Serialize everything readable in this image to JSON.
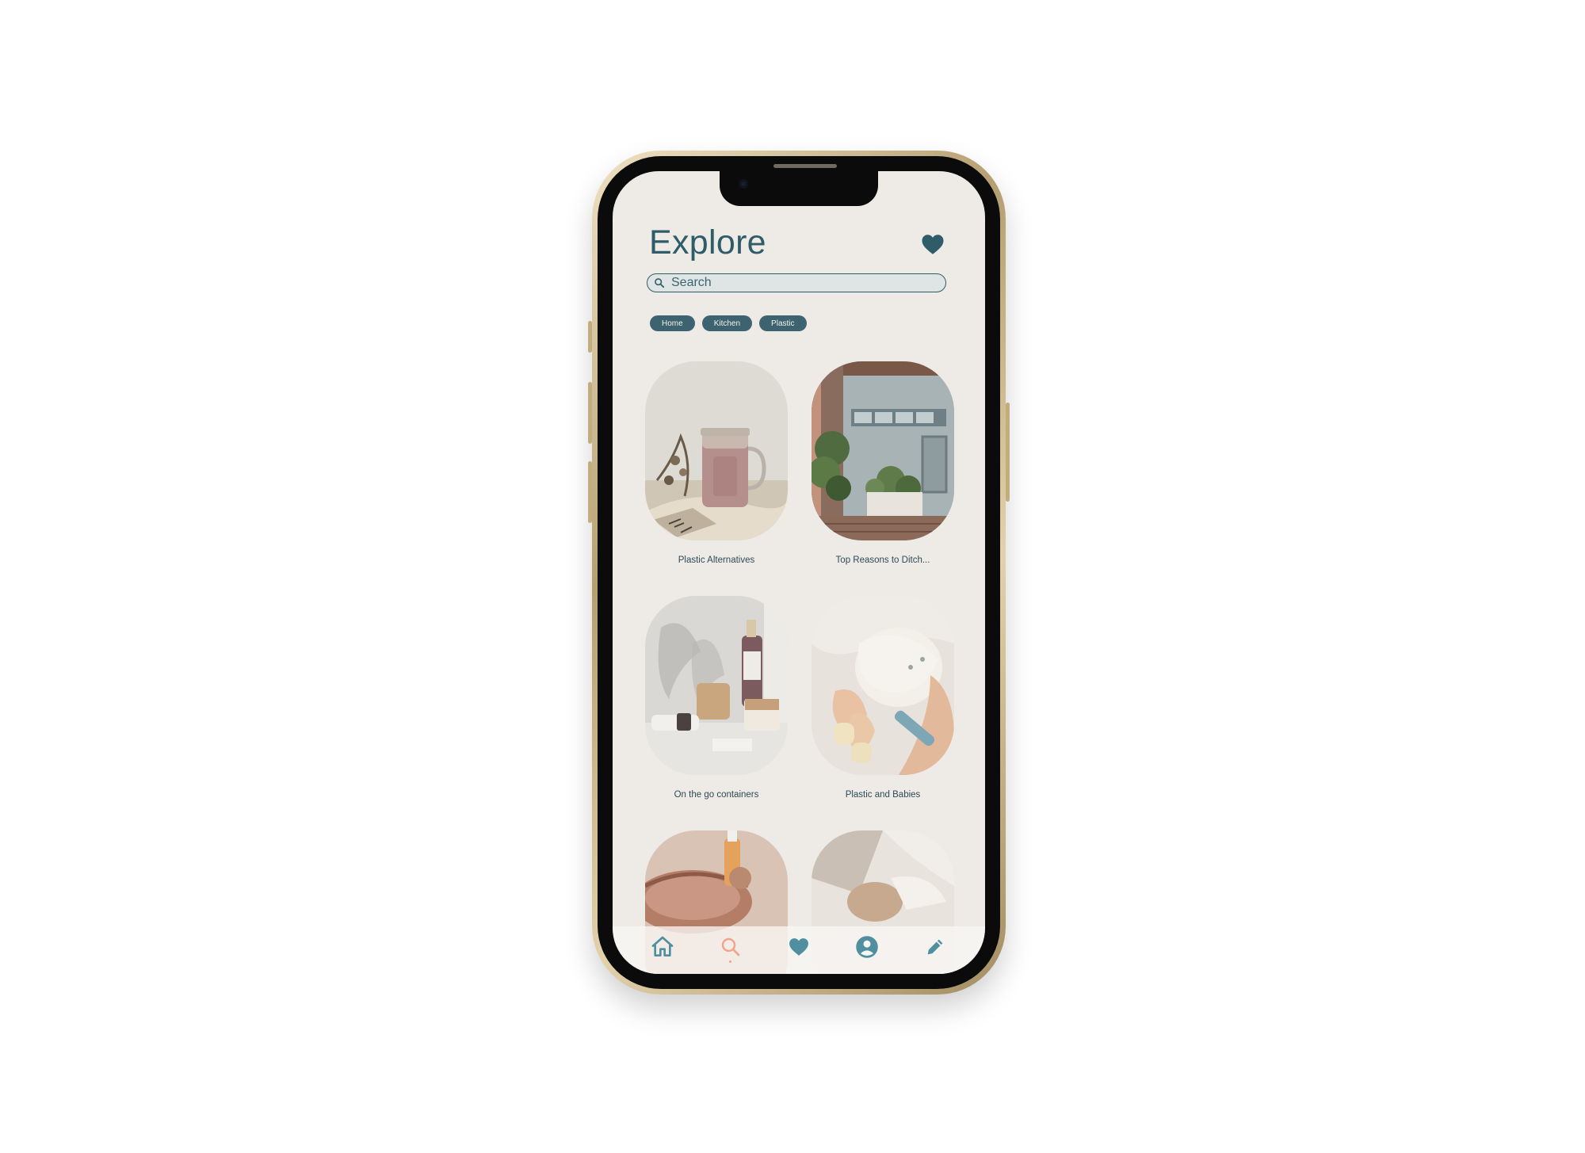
{
  "header": {
    "title": "Explore",
    "favorites_icon": "heart-icon"
  },
  "search": {
    "placeholder": "Search",
    "value": "",
    "icon": "search-icon"
  },
  "filters": [
    {
      "label": "Home"
    },
    {
      "label": "Kitchen"
    },
    {
      "label": "Plastic"
    }
  ],
  "cards": [
    {
      "label": "Plastic Alternatives"
    },
    {
      "label": "Top Reasons to Ditch..."
    },
    {
      "label": "On the go containers"
    },
    {
      "label": "Plastic and Babies"
    },
    {
      "label": ""
    },
    {
      "label": ""
    }
  ],
  "nav": {
    "items": [
      {
        "icon": "home-icon"
      },
      {
        "icon": "search-icon",
        "active": true
      },
      {
        "icon": "heart-icon"
      },
      {
        "icon": "profile-icon"
      },
      {
        "icon": "pencil-icon"
      }
    ]
  },
  "colors": {
    "primary": "#2f5c68",
    "chip": "#3d6370",
    "background": "#eeebe6",
    "active_nav": "#f0a58c",
    "nav_icon": "#4f8fa0"
  }
}
